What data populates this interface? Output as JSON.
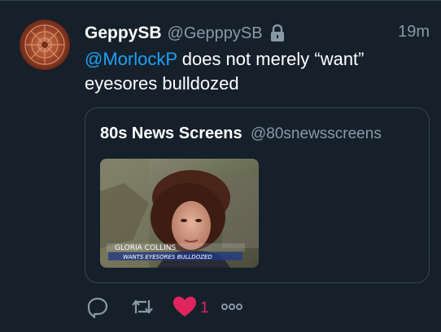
{
  "tweet": {
    "display_name": "GeppySB",
    "handle": "@GepppySB",
    "time": "19m",
    "mention": "@MorlockP",
    "text_rest": " does not merely “want” eyesores bulldozed",
    "protected_icon": "lock-icon"
  },
  "quote": {
    "display_name": "80s News Screens",
    "handle": "@80snewsscreens",
    "caption_line1": "GLORIA  COLLINS",
    "caption_line2": "WANTS EYESORES BULLDOZED"
  },
  "actions": {
    "reply_icon": "reply-icon",
    "retweet_icon": "retweet-icon",
    "like_icon": "heart-icon",
    "like_count": "1",
    "more_icon": "more-icon"
  },
  "colors": {
    "background": "#15202b",
    "border": "#38444d",
    "secondary_text": "#8899a6",
    "link": "#1da1f2",
    "like": "#e0245e"
  }
}
